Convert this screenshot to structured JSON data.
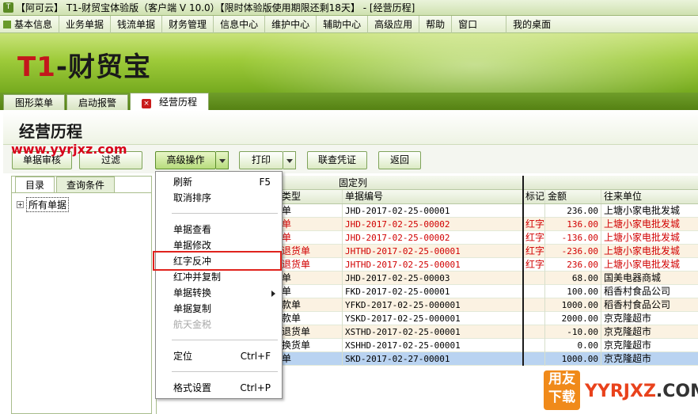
{
  "window": {
    "title": "【阿可云】 T1-财贸宝体验版（客户端 V 10.0）【限时体验版使用期限还剩18天】 - [经营历程]"
  },
  "menubar": {
    "items": [
      "基本信息",
      "业务单据",
      "钱流单据",
      "财务管理",
      "信息中心",
      "维护中心",
      "辅助中心",
      "高级应用",
      "帮助",
      "窗口",
      "我的桌面"
    ]
  },
  "banner": {
    "logo_t1": "T1",
    "logo_rest": "-财贸宝"
  },
  "tabs": [
    {
      "label": "图形菜单"
    },
    {
      "label": "启动报警"
    },
    {
      "label": "经营历程"
    }
  ],
  "page": {
    "title": "经营历程"
  },
  "watermark": "www.yyrjxz.com",
  "toolbar": {
    "review": "单据审核",
    "filter": "过滤",
    "advanced": "高级操作",
    "print": "打印",
    "voucher": "联查凭证",
    "back": "返回"
  },
  "left_panel": {
    "tabs": [
      "目录",
      "查询条件"
    ],
    "tree_expander": "+",
    "tree_root": "所有单据"
  },
  "grid": {
    "fixed_label": "固定列",
    "headers": {
      "type": "类型",
      "no": "单据编号",
      "mark": "标记",
      "amount": "金额",
      "unit": "往来单位"
    },
    "rows": [
      {
        "type": "单",
        "no": "JHD-2017-02-25-00001",
        "mark": "",
        "amount": "236.00",
        "unit": "上塘小家电批发城",
        "style": "normal"
      },
      {
        "type": "单",
        "no": "JHD-2017-02-25-00002",
        "mark": "红字",
        "amount": "136.00",
        "unit": "上塘小家电批发城",
        "style": "red"
      },
      {
        "type": "单",
        "no": "JHD-2017-02-25-00002",
        "mark": "红字",
        "amount": "-136.00",
        "unit": "上塘小家电批发城",
        "style": "red"
      },
      {
        "type": "退货单",
        "no": "JHTHD-2017-02-25-00001",
        "mark": "红字",
        "amount": "-236.00",
        "unit": "上塘小家电批发城",
        "style": "red"
      },
      {
        "type": "退货单",
        "no": "JHTHD-2017-02-25-00001",
        "mark": "红字",
        "amount": "236.00",
        "unit": "上塘小家电批发城",
        "style": "red"
      },
      {
        "type": "单",
        "no": "JHD-2017-02-25-00003",
        "mark": "",
        "amount": "68.00",
        "unit": "国美电器商城",
        "style": "normal"
      },
      {
        "type": "单",
        "no": "FKD-2017-02-25-00001",
        "mark": "",
        "amount": "100.00",
        "unit": "稻香村食品公司",
        "style": "normal"
      },
      {
        "type": "款单",
        "no": "YFKD-2017-02-25-000001",
        "mark": "",
        "amount": "1000.00",
        "unit": "稻香村食品公司",
        "style": "normal"
      },
      {
        "type": "款单",
        "no": "YSKD-2017-02-25-000001",
        "mark": "",
        "amount": "2000.00",
        "unit": "京克隆超市",
        "style": "normal"
      },
      {
        "type": "退货单",
        "no": "XSTHD-2017-02-25-00001",
        "mark": "",
        "amount": "-10.00",
        "unit": "京克隆超市",
        "style": "normal"
      },
      {
        "type": "换货单",
        "no": "XSHHD-2017-02-25-00001",
        "mark": "",
        "amount": "0.00",
        "unit": "京克隆超市",
        "style": "normal"
      },
      {
        "type": "单",
        "no": "SKD-2017-02-27-00001",
        "mark": "",
        "amount": "1000.00",
        "unit": "京克隆超市",
        "style": "selected"
      }
    ]
  },
  "context_menu": {
    "refresh": "刷新",
    "refresh_sc": "F5",
    "unsort": "取消排序",
    "view": "单据查看",
    "modify": "单据修改",
    "red_reverse": "红字反冲",
    "red_copy": "红冲并复制",
    "convert": "单据转换",
    "copy": "单据复制",
    "tax": "航天金税",
    "locate": "定位",
    "locate_sc": "Ctrl+F",
    "format": "格式设置",
    "format_sc": "Ctrl+P"
  },
  "corner_logo": {
    "badge_line1": "用友",
    "badge_line2": "下载",
    "site_y": "YYRJXZ",
    "site_rest": ".COM"
  }
}
